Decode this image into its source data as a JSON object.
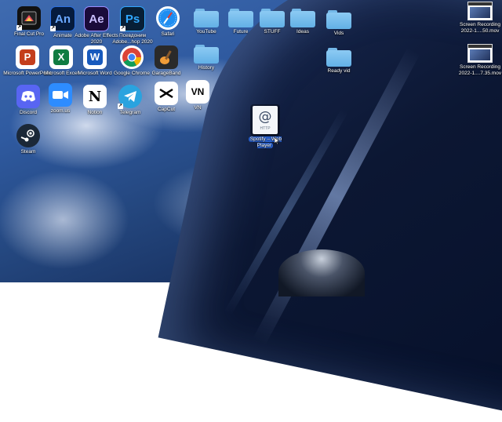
{
  "desktop": {
    "apps": [
      {
        "label": "Final Cut Pro",
        "icon": "final-cut-pro-icon",
        "glyph": "",
        "color": "#1b1b1b"
      },
      {
        "label": "Animate",
        "icon": "animate-icon",
        "glyph": "An",
        "color": "#051b3d"
      },
      {
        "label": "Adobe After Effects 2020",
        "icon": "after-effects-icon",
        "glyph": "Ae",
        "color": "#1a0b3a"
      },
      {
        "label": "Псевдоним Adobe...hop 2020",
        "icon": "photoshop-icon",
        "glyph": "Ps",
        "color": "#071f36"
      },
      {
        "label": "Safari",
        "icon": "safari-icon",
        "glyph": "",
        "color": "#1f8ef1"
      },
      {
        "label": "Microsoft PowerPoint",
        "icon": "powerpoint-icon",
        "glyph": "P",
        "color": "#c43e1c"
      },
      {
        "label": "Microsoft Excel",
        "icon": "excel-icon",
        "glyph": "X",
        "color": "#107c41"
      },
      {
        "label": "Microsoft Word",
        "icon": "word-icon",
        "glyph": "W",
        "color": "#185abd"
      },
      {
        "label": "Google Chrome",
        "icon": "chrome-icon",
        "glyph": "",
        "color": "#ffffff"
      },
      {
        "label": "GarageBand",
        "icon": "garageband-icon",
        "glyph": "",
        "color": "#1e1e1e"
      },
      {
        "label": "Discord",
        "icon": "discord-icon",
        "glyph": "",
        "color": "#5865f2"
      },
      {
        "label": "zoom.us",
        "icon": "zoom-icon",
        "glyph": "",
        "color": "#2d8cff"
      },
      {
        "label": "Notion",
        "icon": "notion-icon",
        "glyph": "N",
        "color": "#ffffff"
      },
      {
        "label": "Telegram",
        "icon": "telegram-icon",
        "glyph": "",
        "color": "#2aa3df"
      },
      {
        "label": "CapCut",
        "icon": "capcut-icon",
        "glyph": "",
        "color": "#ffffff"
      },
      {
        "label": "VN",
        "icon": "vn-icon",
        "glyph": "VN",
        "color": "#ffffff"
      },
      {
        "label": "Steam",
        "icon": "steam-icon",
        "glyph": "",
        "color": "#1b2838"
      }
    ],
    "folders": [
      {
        "label": "YouTube"
      },
      {
        "label": "Future"
      },
      {
        "label": "STUFF"
      },
      {
        "label": "Ideas"
      },
      {
        "label": "Vids"
      },
      {
        "label": "History"
      },
      {
        "label": "Ready vid"
      }
    ],
    "files": [
      {
        "label": "Screen Recording 2022-1....50.mov",
        "icon": "screen-recording-file-icon"
      },
      {
        "label": "Screen Recording 2022-1....7.35.mov",
        "icon": "screen-recording-file-icon"
      }
    ],
    "webloc": {
      "label": "Spotify – Web Player",
      "glyph": "@",
      "type": "HTTP",
      "icon": "webloc-file-icon"
    }
  }
}
